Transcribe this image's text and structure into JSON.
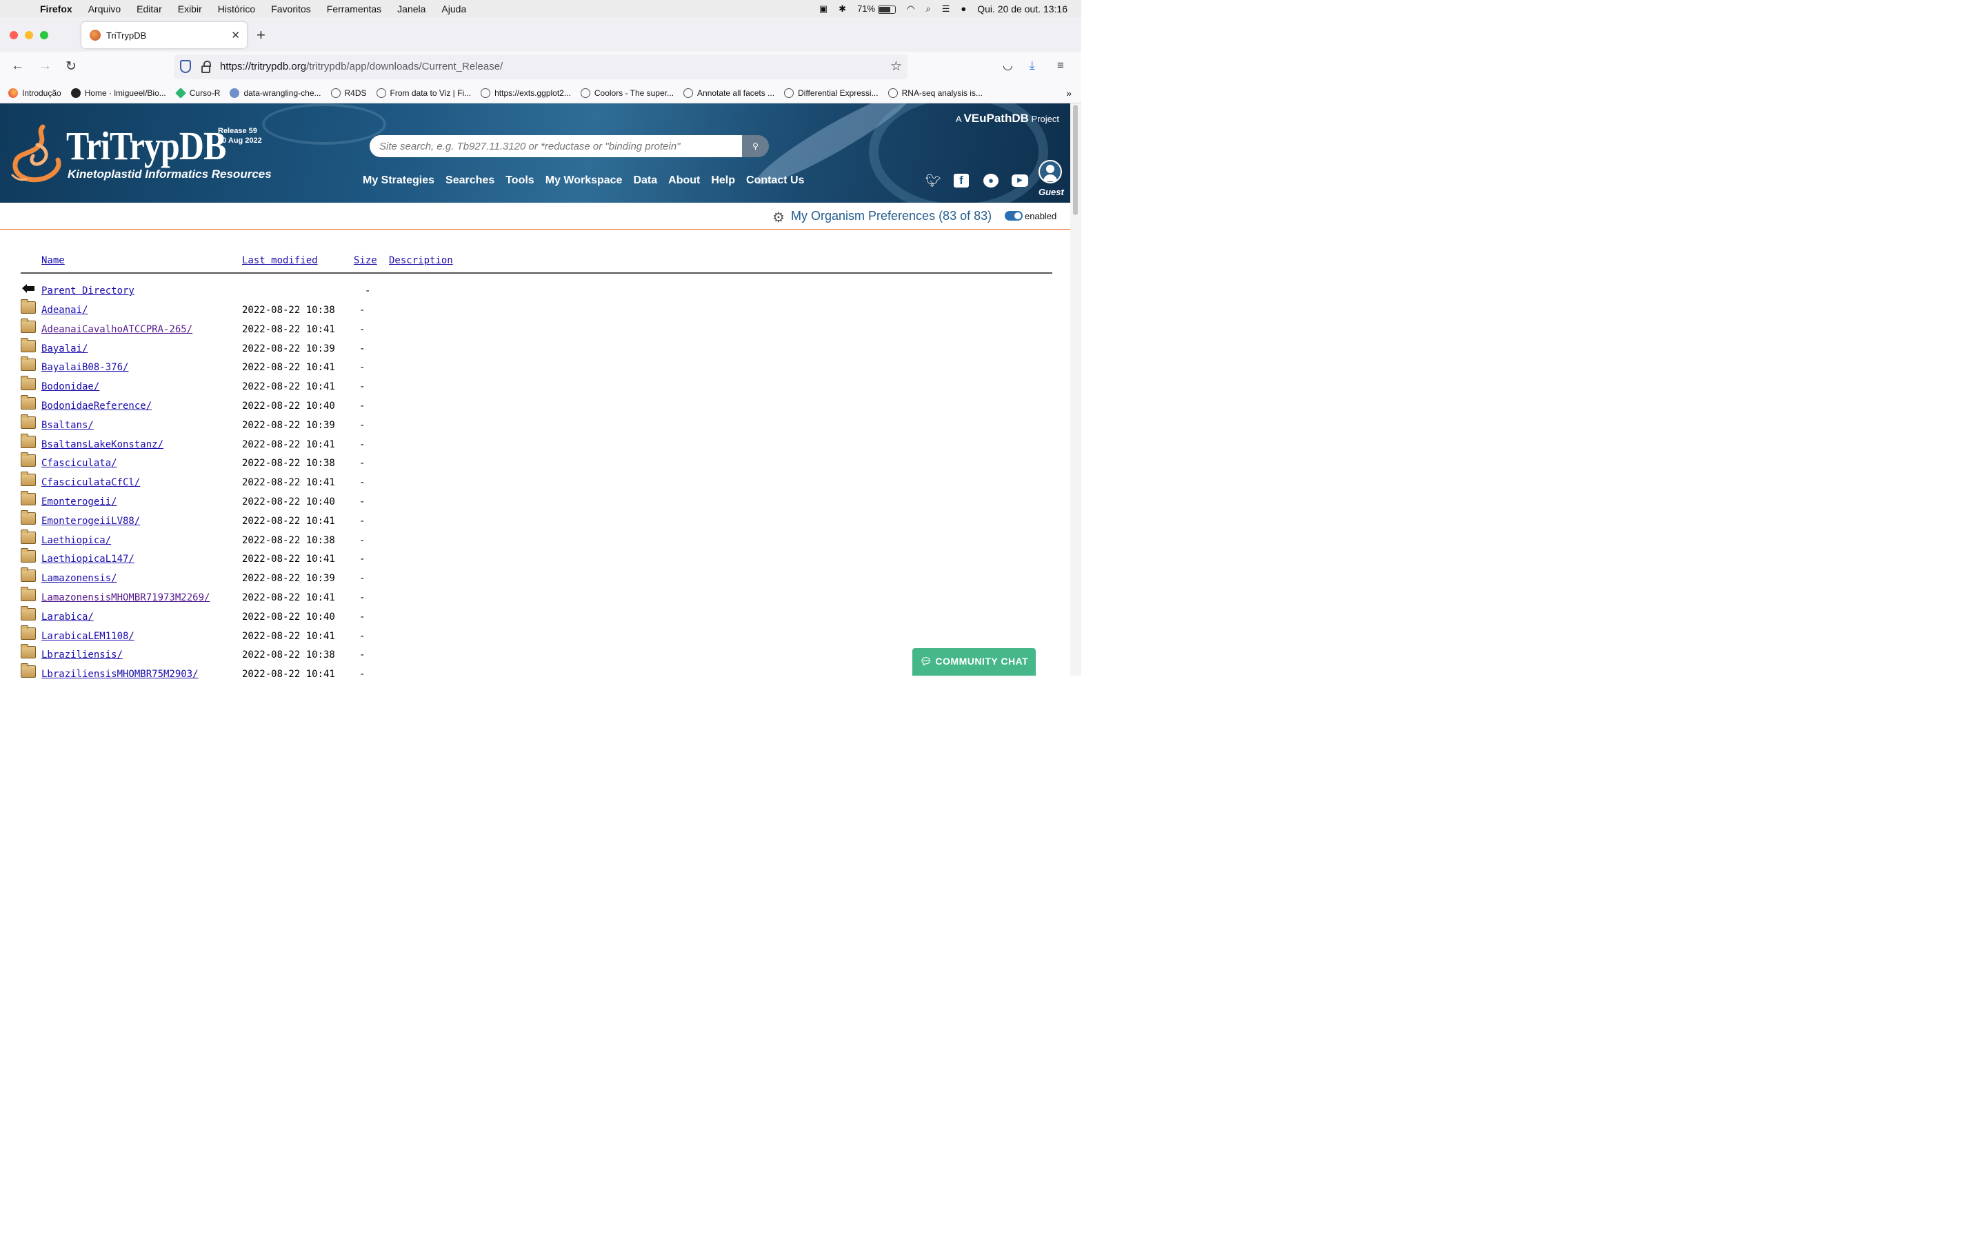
{
  "menubar": {
    "app": "Firefox",
    "items": [
      "Arquivo",
      "Editar",
      "Exibir",
      "Histórico",
      "Favoritos",
      "Ferramentas",
      "Janela",
      "Ajuda"
    ],
    "battery": "71%",
    "datetime": "Qui. 20 de out.  13:16"
  },
  "tab": {
    "title": "TriTrypDB"
  },
  "urlbar": {
    "host": "https://tritrypdb.org",
    "path": "/tritrypdb/app/downloads/Current_Release/"
  },
  "bookmarks": [
    {
      "label": "Introdução",
      "icon": "firefox-icon"
    },
    {
      "label": "Home · lmigueel/Bio...",
      "icon": "github-icon"
    },
    {
      "label": "Curso-R",
      "icon": "curso-r-icon"
    },
    {
      "label": "data-wrangling-che...",
      "icon": "r-icon"
    },
    {
      "label": "R4DS",
      "icon": "globe-icon"
    },
    {
      "label": "From data to Viz | Fi...",
      "icon": "globe-icon"
    },
    {
      "label": "https://exts.ggplot2...",
      "icon": "globe-icon"
    },
    {
      "label": "Coolors - The super...",
      "icon": "globe-icon"
    },
    {
      "label": "Annotate all facets ...",
      "icon": "globe-icon"
    },
    {
      "label": "Differential Expressi...",
      "icon": "globe-icon"
    },
    {
      "label": "RNA-seq analysis is...",
      "icon": "globe-icon"
    }
  ],
  "site": {
    "title": "TriTrypDB",
    "subtitle": "Kinetoplastid Informatics Resources",
    "release_line1": "Release 59",
    "release_line2": "30 Aug 2022",
    "veu_prefix": "A",
    "veu_name": "VEuPathDB",
    "veu_suffix": "Project",
    "search_placeholder": "Site search, e.g. Tb927.11.3120 or *reductase or \"binding protein\"",
    "nav": [
      "My Strategies",
      "Searches",
      "Tools",
      "My Workspace",
      "Data",
      "About",
      "Help",
      "Contact Us"
    ],
    "guest": "Guest"
  },
  "prefs": {
    "label": "My Organism Preferences (83 of 83)",
    "toggle": "enabled"
  },
  "listing": {
    "headers": {
      "name": "Name",
      "modified": "Last modified",
      "size": "Size",
      "description": "Description"
    },
    "parent": {
      "name": "Parent Directory",
      "size": "-"
    },
    "rows": [
      {
        "name": "Adeanai/",
        "date": "2022-08-22 10:38",
        "size": "-",
        "visited": false
      },
      {
        "name": "AdeanaiCavalhoATCCPRA-265/",
        "date": "2022-08-22 10:41",
        "size": "-",
        "visited": true
      },
      {
        "name": "Bayalai/",
        "date": "2022-08-22 10:39",
        "size": "-",
        "visited": false
      },
      {
        "name": "BayalaiB08-376/",
        "date": "2022-08-22 10:41",
        "size": "-",
        "visited": false
      },
      {
        "name": "Bodonidae/",
        "date": "2022-08-22 10:41",
        "size": "-",
        "visited": false
      },
      {
        "name": "BodonidaeReference/",
        "date": "2022-08-22 10:40",
        "size": "-",
        "visited": false
      },
      {
        "name": "Bsaltans/",
        "date": "2022-08-22 10:39",
        "size": "-",
        "visited": false
      },
      {
        "name": "BsaltansLakeKonstanz/",
        "date": "2022-08-22 10:41",
        "size": "-",
        "visited": false
      },
      {
        "name": "Cfasciculata/",
        "date": "2022-08-22 10:38",
        "size": "-",
        "visited": false
      },
      {
        "name": "CfasciculataCfCl/",
        "date": "2022-08-22 10:41",
        "size": "-",
        "visited": false
      },
      {
        "name": "Emonterogeii/",
        "date": "2022-08-22 10:40",
        "size": "-",
        "visited": false
      },
      {
        "name": "EmonterogeiiLV88/",
        "date": "2022-08-22 10:41",
        "size": "-",
        "visited": false
      },
      {
        "name": "Laethiopica/",
        "date": "2022-08-22 10:38",
        "size": "-",
        "visited": false
      },
      {
        "name": "LaethiopicaL147/",
        "date": "2022-08-22 10:41",
        "size": "-",
        "visited": false
      },
      {
        "name": "Lamazonensis/",
        "date": "2022-08-22 10:39",
        "size": "-",
        "visited": false
      },
      {
        "name": "LamazonensisMHOMBR71973M2269/",
        "date": "2022-08-22 10:41",
        "size": "-",
        "visited": true
      },
      {
        "name": "Larabica/",
        "date": "2022-08-22 10:40",
        "size": "-",
        "visited": false
      },
      {
        "name": "LarabicaLEM1108/",
        "date": "2022-08-22 10:41",
        "size": "-",
        "visited": false
      },
      {
        "name": "Lbraziliensis/",
        "date": "2022-08-22 10:38",
        "size": "-",
        "visited": false
      },
      {
        "name": "LbraziliensisMHOMBR75M2903/",
        "date": "2022-08-22 10:41",
        "size": "-",
        "visited": false
      }
    ]
  },
  "chat": {
    "label": "COMMUNITY CHAT"
  },
  "colors": {
    "header_dark": "#0f3a5c",
    "link": "#1a0dab",
    "visited": "#551a8b",
    "accent_rule": "#e06c2e",
    "chat": "#45b789"
  }
}
